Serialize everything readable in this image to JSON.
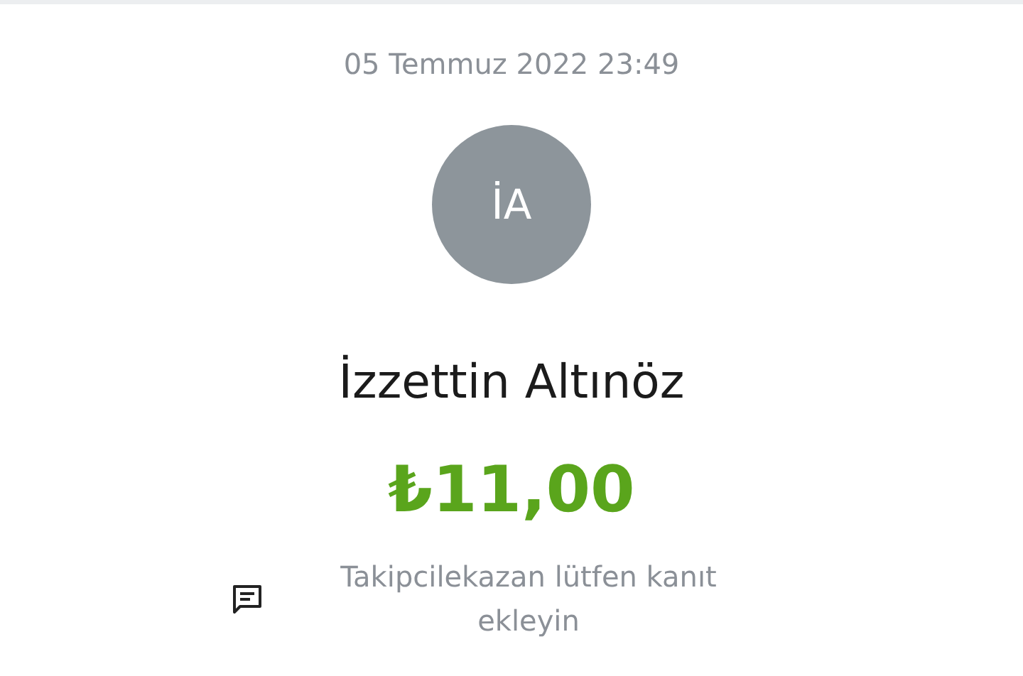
{
  "date": "05 Temmuz 2022 23:49",
  "avatar": {
    "initials": "İA"
  },
  "name": "İzzettin Altınöz",
  "amount": "₺11,00",
  "note": {
    "text": "Takipcilekazan lütfen kanıt ekleyin"
  }
}
